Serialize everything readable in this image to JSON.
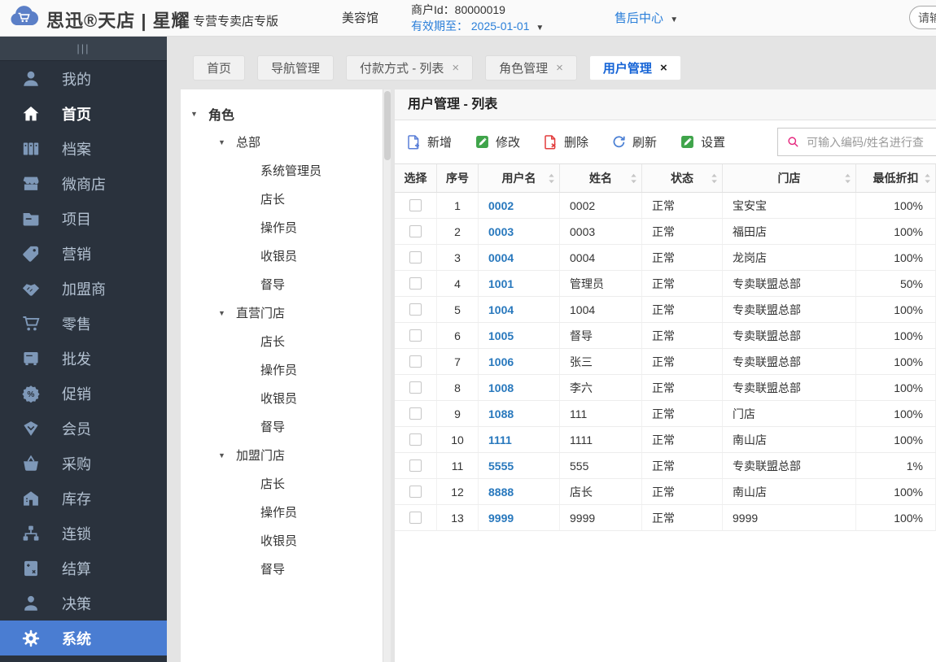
{
  "header": {
    "logo_text": "思迅®天店 | 星耀",
    "edition": "专营专卖店专版",
    "store_name": "美容馆",
    "merchant_id": "商户Id：80000019",
    "validity_label": "有效期至：",
    "validity_date": "2025-01-01",
    "service_center": "售后中心",
    "topbar_input_placeholder": "请输"
  },
  "sidebar": {
    "collapse_glyph": "|||",
    "items": [
      {
        "id": "mine",
        "label": "我的",
        "icon": "person-icon"
      },
      {
        "id": "home",
        "label": "首页",
        "icon": "home-icon",
        "current": true
      },
      {
        "id": "archives",
        "label": "档案",
        "icon": "archive-icon"
      },
      {
        "id": "micro-store",
        "label": "微商店",
        "icon": "store-icon"
      },
      {
        "id": "projects",
        "label": "项目",
        "icon": "folder-icon"
      },
      {
        "id": "marketing",
        "label": "营销",
        "icon": "tag-icon"
      },
      {
        "id": "franchisee",
        "label": "加盟商",
        "icon": "handshake-icon"
      },
      {
        "id": "retail",
        "label": "零售",
        "icon": "cart-icon"
      },
      {
        "id": "wholesale",
        "label": "批发",
        "icon": "cabinet-icon"
      },
      {
        "id": "promotion",
        "label": "促销",
        "icon": "percent-badge-icon"
      },
      {
        "id": "members",
        "label": "会员",
        "icon": "gem-icon"
      },
      {
        "id": "purchasing",
        "label": "采购",
        "icon": "basket-icon"
      },
      {
        "id": "inventory",
        "label": "库存",
        "icon": "warehouse-icon"
      },
      {
        "id": "chain",
        "label": "连锁",
        "icon": "org-tree-icon"
      },
      {
        "id": "settlement",
        "label": "结算",
        "icon": "calculator-icon"
      },
      {
        "id": "decision",
        "label": "决策",
        "icon": "person-stamp-icon"
      },
      {
        "id": "system",
        "label": "系统",
        "icon": "gear-icon",
        "selected": true
      }
    ]
  },
  "tabs": [
    {
      "label": "首页",
      "closable": false,
      "active": false
    },
    {
      "label": "导航管理",
      "closable": false,
      "active": false
    },
    {
      "label": "付款方式 - 列表",
      "closable": true,
      "active": false
    },
    {
      "label": "角色管理",
      "closable": true,
      "active": false
    },
    {
      "label": "用户管理",
      "closable": true,
      "active": true
    }
  ],
  "tree": {
    "nodes": [
      {
        "label": "角色",
        "level": 0,
        "expanded": true
      },
      {
        "label": "总部",
        "level": 1,
        "expanded": true
      },
      {
        "label": "系统管理员",
        "level": 2
      },
      {
        "label": "店长",
        "level": 2
      },
      {
        "label": "操作员",
        "level": 2
      },
      {
        "label": "收银员",
        "level": 2
      },
      {
        "label": "督导",
        "level": 2
      },
      {
        "label": "直营门店",
        "level": 1,
        "expanded": true
      },
      {
        "label": "店长",
        "level": 2
      },
      {
        "label": "操作员",
        "level": 2
      },
      {
        "label": "收银员",
        "level": 2
      },
      {
        "label": "督导",
        "level": 2
      },
      {
        "label": "加盟门店",
        "level": 1,
        "expanded": true
      },
      {
        "label": "店长",
        "level": 2
      },
      {
        "label": "操作员",
        "level": 2
      },
      {
        "label": "收银员",
        "level": 2
      },
      {
        "label": "督导",
        "level": 2
      }
    ]
  },
  "panel": {
    "title": "用户管理 - 列表",
    "toolbar": {
      "buttons": [
        {
          "id": "add",
          "label": "新增",
          "icon": "add-file-icon"
        },
        {
          "id": "modify",
          "label": "修改",
          "icon": "edit-pencil-icon"
        },
        {
          "id": "delete",
          "label": "删除",
          "icon": "delete-file-icon"
        },
        {
          "id": "refresh",
          "label": "刷新",
          "icon": "refresh-icon"
        },
        {
          "id": "settings",
          "label": "设置",
          "icon": "settings-pencil-icon"
        }
      ],
      "search_placeholder": "可输入编码/姓名进行查"
    },
    "table": {
      "columns": [
        {
          "key": "select",
          "label": "选择",
          "sortable": false
        },
        {
          "key": "seq",
          "label": "序号",
          "sortable": false
        },
        {
          "key": "username",
          "label": "用户名",
          "sortable": true
        },
        {
          "key": "name",
          "label": "姓名",
          "sortable": true
        },
        {
          "key": "status",
          "label": "状态",
          "sortable": true
        },
        {
          "key": "store",
          "label": "门店",
          "sortable": true
        },
        {
          "key": "discount",
          "label": "最低折扣",
          "sortable": true
        }
      ],
      "rows": [
        {
          "seq": "1",
          "username": "0002",
          "name": "0002",
          "status": "正常",
          "store": "宝安宝",
          "discount": "100%"
        },
        {
          "seq": "2",
          "username": "0003",
          "name": "0003",
          "status": "正常",
          "store": "福田店",
          "discount": "100%"
        },
        {
          "seq": "3",
          "username": "0004",
          "name": "0004",
          "status": "正常",
          "store": "龙岗店",
          "discount": "100%"
        },
        {
          "seq": "4",
          "username": "1001",
          "name": "管理员",
          "status": "正常",
          "store": "专卖联盟总部",
          "discount": "50%"
        },
        {
          "seq": "5",
          "username": "1004",
          "name": "1004",
          "status": "正常",
          "store": "专卖联盟总部",
          "discount": "100%"
        },
        {
          "seq": "6",
          "username": "1005",
          "name": "督导",
          "status": "正常",
          "store": "专卖联盟总部",
          "discount": "100%"
        },
        {
          "seq": "7",
          "username": "1006",
          "name": "张三",
          "status": "正常",
          "store": "专卖联盟总部",
          "discount": "100%"
        },
        {
          "seq": "8",
          "username": "1008",
          "name": "李六",
          "status": "正常",
          "store": "专卖联盟总部",
          "discount": "100%"
        },
        {
          "seq": "9",
          "username": "1088",
          "name": "111",
          "status": "正常",
          "store": "门店",
          "discount": "100%"
        },
        {
          "seq": "10",
          "username": "1111",
          "name": "1111",
          "status": "正常",
          "store": "南山店",
          "discount": "100%"
        },
        {
          "seq": "11",
          "username": "5555",
          "name": "555",
          "status": "正常",
          "store": "专卖联盟总部",
          "discount": "1%"
        },
        {
          "seq": "12",
          "username": "8888",
          "name": "店长",
          "status": "正常",
          "store": "南山店",
          "discount": "100%"
        },
        {
          "seq": "13",
          "username": "9999",
          "name": "9999",
          "status": "正常",
          "store": "9999",
          "discount": "100%"
        }
      ]
    }
  },
  "colors": {
    "sidebar_bg": "#2a323d",
    "sidebar_active_blue": "#4a7dd2",
    "table_link_blue": "#2878bd",
    "header_link_blue": "#2b7fd9",
    "tab_active_blue": "#1463d6",
    "toolbar_blue": "#5a7fd8",
    "toolbar_green": "#3fa44a",
    "toolbar_red": "#e23d3d",
    "refresh_blue": "#4a7fd4",
    "search_pink": "#e5257d"
  }
}
